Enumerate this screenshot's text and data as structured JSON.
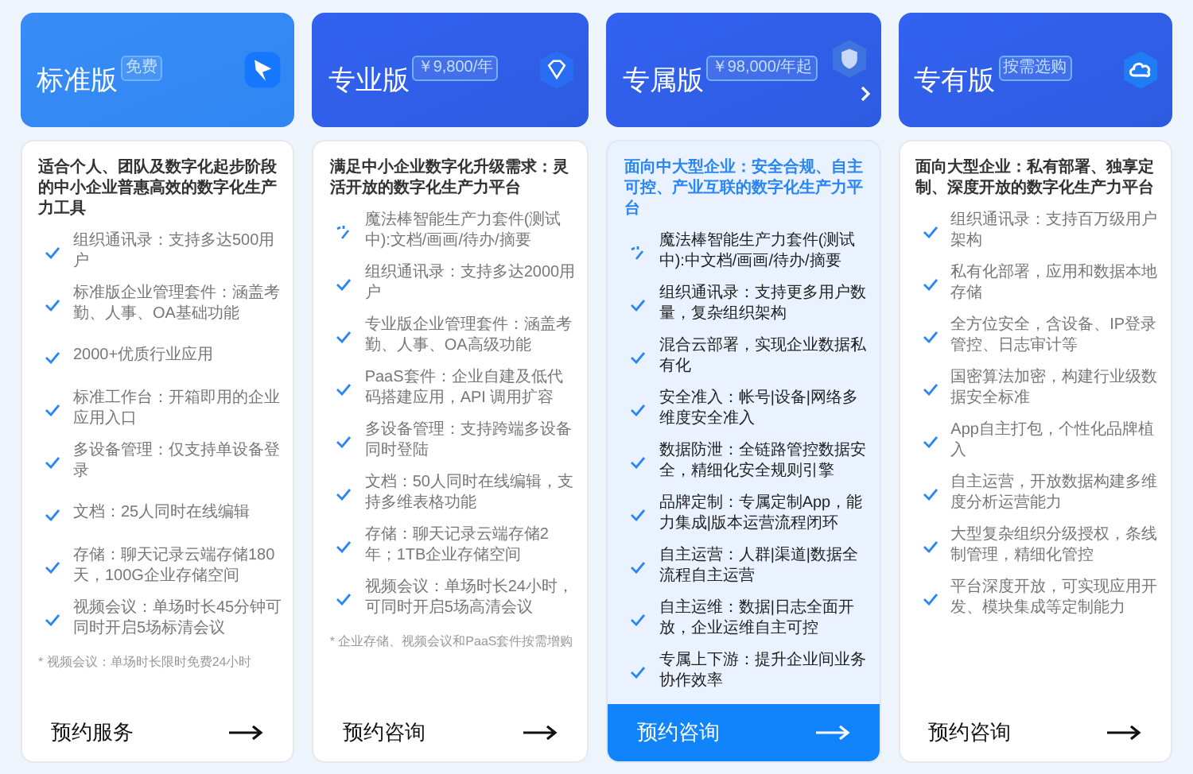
{
  "plans": [
    {
      "title": "标准版",
      "badge": "免费",
      "chevron": false,
      "selected": false,
      "description": "适合个人、团队及数字化起步阶段的中小企业普惠高效的数字化生产力工具",
      "features": [
        {
          "kind": "check",
          "text": "组织通讯录：支持多达500用户"
        },
        {
          "kind": "check",
          "text": "标准版企业管理套件：涵盖考勤、人事、OA基础功能"
        },
        {
          "kind": "check",
          "text": "2000+优质行业应用"
        },
        {
          "kind": "check",
          "text": "标准工作台：开箱即用的企业应用入口"
        },
        {
          "kind": "check",
          "text": "多设备管理：仅支持单设备登录"
        },
        {
          "kind": "check",
          "text": "文档：25人同时在线编辑"
        },
        {
          "kind": "check",
          "text": "存储：聊天记录云端存储180天，100G企业存储空间"
        },
        {
          "kind": "check",
          "text": "视频会议：单场时长45分钟可同时开启5场标清会议"
        }
      ],
      "footnote": "* 视频会议：单场时长限时免费24小时",
      "cta": "预约服务"
    },
    {
      "title": "专业版",
      "badge": "￥9,800/年",
      "chevron": false,
      "selected": false,
      "description": "满足中小企业数字化升级需求：灵活开放的数字化生产力平台",
      "features": [
        {
          "kind": "wand",
          "text": "魔法棒智能生产力套件(测试中):文档/画画/待办/摘要"
        },
        {
          "kind": "check",
          "text": "组织通讯录：支持多达2000用户"
        },
        {
          "kind": "check",
          "text": "专业版企业管理套件：涵盖考勤、人事、OA高级功能"
        },
        {
          "kind": "check",
          "text": "PaaS套件：企业自建及低代码搭建应用，API 调用扩容"
        },
        {
          "kind": "check",
          "text": "多设备管理：支持跨端多设备同时登陆"
        },
        {
          "kind": "check",
          "text": "文档：50人同时在线编辑，支持多维表格功能"
        },
        {
          "kind": "check",
          "text": "存储：聊天记录云端存储2年；1TB企业存储空间"
        },
        {
          "kind": "check",
          "text": "视频会议：单场时长24小时，可同时开启5场高清会议"
        }
      ],
      "footnote": "* 企业存储、视频会议和PaaS套件按需增购",
      "cta": "预约咨询"
    },
    {
      "title": "专属版",
      "badge": "￥98,000/年起",
      "chevron": true,
      "selected": true,
      "description": "面向中大型企业：安全合规、自主可控、产业互联的数字化生产力平台",
      "features": [
        {
          "kind": "wand",
          "text": "魔法棒智能生产力套件(测试中):中文档/画画/待办/摘要"
        },
        {
          "kind": "check",
          "text": "组织通讯录：支持更多用户数量，复杂组织架构"
        },
        {
          "kind": "check",
          "text": "混合云部署，实现企业数据私有化"
        },
        {
          "kind": "check",
          "text": "安全准入：帐号|设备|网络多维度安全准入"
        },
        {
          "kind": "check",
          "text": "数据防泄：全链路管控数据安全，精细化安全规则引擎"
        },
        {
          "kind": "check",
          "text": "品牌定制：专属定制App，能力集成|版本运营流程闭环"
        },
        {
          "kind": "check",
          "text": "自主运营：人群|渠道|数据全流程自主运营"
        },
        {
          "kind": "check",
          "text": "自主运维：数据|日志全面开放，企业运维自主可控"
        },
        {
          "kind": "check",
          "text": "专属上下游：提升企业间业务协作效率"
        }
      ],
      "cta": "预约咨询"
    },
    {
      "title": "专有版",
      "badge": "按需选购",
      "chevron": false,
      "selected": false,
      "description": "面向大型企业：私有部署、独享定制、深度开放的数字化生产力平台",
      "features": [
        {
          "kind": "check",
          "text": "组织通讯录：支持百万级用户架构"
        },
        {
          "kind": "check",
          "text": "私有化部署，应用和数据本地存储"
        },
        {
          "kind": "check",
          "text": "全方位安全，含设备、IP登录管控、日志审计等"
        },
        {
          "kind": "check",
          "text": "国密算法加密，构建行业级数据安全标准"
        },
        {
          "kind": "check",
          "text": "App自主打包，个性化品牌植入"
        },
        {
          "kind": "check",
          "text": "自主运营，开放数据构建多维度分析运营能力"
        },
        {
          "kind": "check",
          "text": "大型复杂组织分级授权，条线制管理，精细化管控"
        },
        {
          "kind": "check",
          "text": "平台深度开放，可实现应用开发、模块集成等定制能力"
        }
      ],
      "cta": "预约咨询"
    }
  ]
}
